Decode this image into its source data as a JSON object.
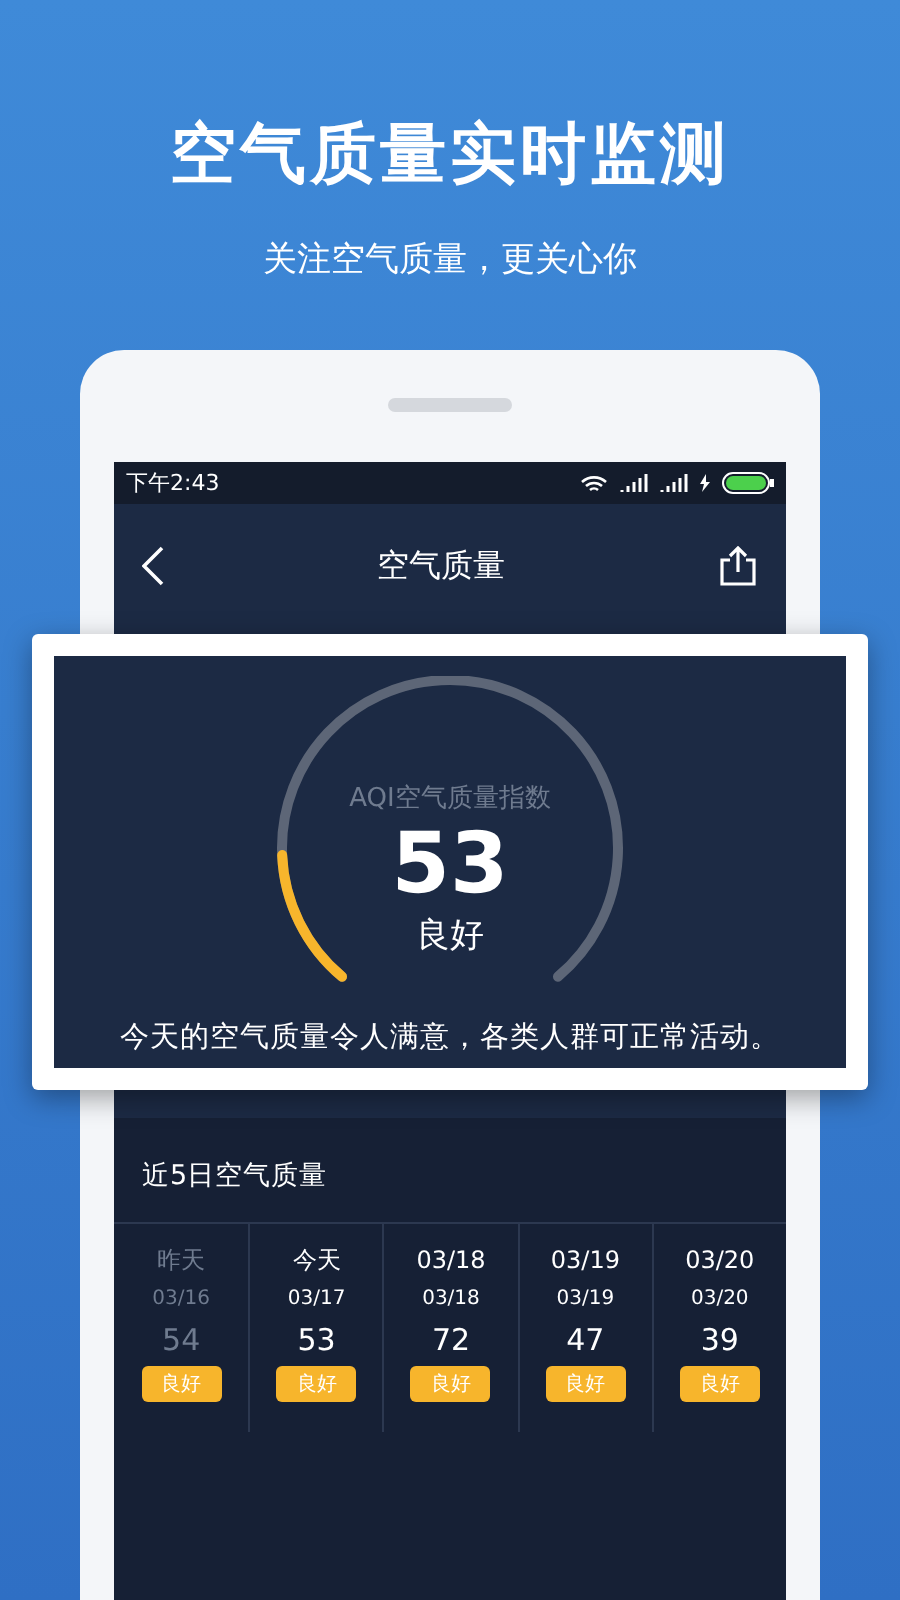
{
  "headline": {
    "title": "空气质量实时监测",
    "subtitle": "关注空气质量，更关心你"
  },
  "status_bar": {
    "time": "下午2:43"
  },
  "nav": {
    "title": "空气质量"
  },
  "aqi_card": {
    "caption": "AQI空气质量指数",
    "value": "53",
    "grade": "良好",
    "level": 0.17,
    "advice": "今天的空气质量令人满意，各类人群可正常活动。"
  },
  "forecast": {
    "title": "近5日空气质量",
    "days": [
      {
        "label": "昨天",
        "date": "03/16",
        "value": "54",
        "grade": "良好",
        "past": true
      },
      {
        "label": "今天",
        "date": "03/17",
        "value": "53",
        "grade": "良好",
        "past": false
      },
      {
        "label": "03/18",
        "date": "03/18",
        "value": "72",
        "grade": "良好",
        "past": false
      },
      {
        "label": "03/19",
        "date": "03/19",
        "value": "47",
        "grade": "良好",
        "past": false
      },
      {
        "label": "03/20",
        "date": "03/20",
        "value": "39",
        "grade": "良好",
        "past": false
      }
    ]
  }
}
